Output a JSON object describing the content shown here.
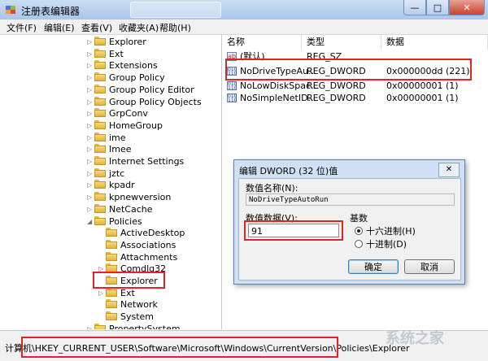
{
  "window": {
    "title": "注册表编辑器",
    "buttons": {
      "minimize": "—",
      "maximize": "□",
      "close": "✕"
    }
  },
  "menu": [
    "文件(F)",
    "编辑(E)",
    "查看(V)",
    "收藏夹(A)",
    "帮助(H)"
  ],
  "tree": [
    {
      "label": "Explorer",
      "indent": 1,
      "expander": "▷"
    },
    {
      "label": "Ext",
      "indent": 1,
      "expander": "▷"
    },
    {
      "label": "Extensions",
      "indent": 1,
      "expander": "▷"
    },
    {
      "label": "Group Policy",
      "indent": 1,
      "expander": "▷"
    },
    {
      "label": "Group Policy Editor",
      "indent": 1,
      "expander": "▷"
    },
    {
      "label": "Group Policy Objects",
      "indent": 1,
      "expander": "▷"
    },
    {
      "label": "GrpConv",
      "indent": 1,
      "expander": "▷"
    },
    {
      "label": "HomeGroup",
      "indent": 1,
      "expander": "▷"
    },
    {
      "label": "ime",
      "indent": 1,
      "expander": "▷"
    },
    {
      "label": "Imee",
      "indent": 1,
      "expander": "▷"
    },
    {
      "label": "Internet Settings",
      "indent": 1,
      "expander": "▷"
    },
    {
      "label": "jztc",
      "indent": 1,
      "expander": "▷"
    },
    {
      "label": "kpadr",
      "indent": 1,
      "expander": "▷"
    },
    {
      "label": "kpnewversion",
      "indent": 1,
      "expander": "▷"
    },
    {
      "label": "NetCache",
      "indent": 1,
      "expander": "▷"
    },
    {
      "label": "Policies",
      "indent": 1,
      "expander": "◢"
    },
    {
      "label": "ActiveDesktop",
      "indent": 2,
      "expander": ""
    },
    {
      "label": "Associations",
      "indent": 2,
      "expander": ""
    },
    {
      "label": "Attachments",
      "indent": 2,
      "expander": ""
    },
    {
      "label": "Comdlg32",
      "indent": 2,
      "expander": "▷"
    },
    {
      "label": "Explorer",
      "indent": 2,
      "expander": "",
      "selected": true
    },
    {
      "label": "Ext",
      "indent": 2,
      "expander": "▷"
    },
    {
      "label": "Network",
      "indent": 2,
      "expander": ""
    },
    {
      "label": "System",
      "indent": 2,
      "expander": ""
    },
    {
      "label": "PropertySystem",
      "indent": 1,
      "expander": "▷"
    }
  ],
  "columns": {
    "name": "名称",
    "type": "类型",
    "data": "数据"
  },
  "values": [
    {
      "icon": "string",
      "name": "(默认)",
      "type": "REG_SZ",
      "data": ""
    },
    {
      "icon": "dword",
      "name": "NoDriveTypeAu...",
      "type": "REG_DWORD",
      "data": "0x000000dd (221)"
    },
    {
      "icon": "dword",
      "name": "NoLowDiskSpac...",
      "type": "REG_DWORD",
      "data": "0x00000001 (1)"
    },
    {
      "icon": "dword",
      "name": "NoSimpleNetID...",
      "type": "REG_DWORD",
      "data": "0x00000001 (1)"
    }
  ],
  "dialog": {
    "title": "编辑 DWORD (32 位)值",
    "close": "✕",
    "name_label": "数值名称(N):",
    "name_value": "NoDriveTypeAutoRun",
    "data_label": "数值数据(V):",
    "data_value": "91",
    "base_label": "基数",
    "radio_hex": "十六进制(H)",
    "radio_dec": "十进制(D)",
    "selected_base": "hex",
    "ok": "确定",
    "cancel": "取消"
  },
  "status_path": "计算机\\HKEY_CURRENT_USER\\Software\\Microsoft\\Windows\\CurrentVersion\\Policies\\Explorer",
  "watermark": "系统之家",
  "colors": {
    "highlight": "#e02323",
    "titlebar": "#b9d1ef"
  }
}
